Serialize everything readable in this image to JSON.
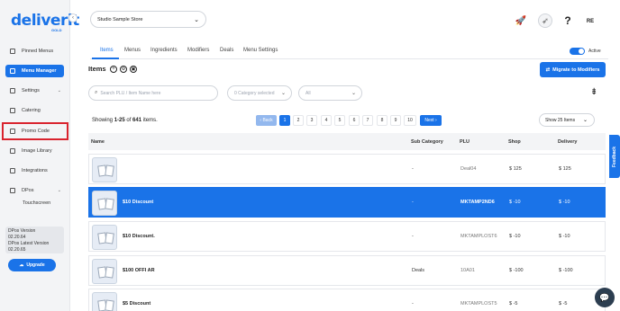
{
  "brand": {
    "logo": "deliverit",
    "logo_sub": "GOLD"
  },
  "sidebar": {
    "items": [
      {
        "label": "Pinned Menus",
        "icon": "pin-icon"
      },
      {
        "label": "Menu Manager",
        "icon": "menu-icon",
        "active": true
      },
      {
        "label": "Settings",
        "icon": "gear-icon"
      },
      {
        "label": "Catering",
        "icon": "catering-icon"
      },
      {
        "label": "Promo Code",
        "icon": "ticket-icon"
      },
      {
        "label": "Image Library",
        "icon": "image-icon"
      },
      {
        "label": "Integrations",
        "icon": "link-icon"
      },
      {
        "label": "DPos",
        "icon": "pos-icon"
      }
    ],
    "sub_item": "Touchscreen",
    "version_label": "DPos Version",
    "version_value": "02.20.64",
    "latest_label": "DPos Latest Version",
    "latest_value": "02.20.65",
    "upgrade_label": "Upgrade"
  },
  "header": {
    "store": "Studio Sample Store",
    "avatar": "RE"
  },
  "tabs": [
    "Items",
    "Menus",
    "Ingredients",
    "Modifiers",
    "Deals",
    "Menu Settings"
  ],
  "active_toggle_label": "Active",
  "items_title": "Items",
  "migrate_label": "Migrate to Modifiers",
  "search_placeholder": "Search PLU / Item Name here",
  "category_placeholder": "0 Category selected",
  "all_placeholder": "All",
  "pagination": {
    "showing_prefix": "Showing ",
    "range": "1-25",
    "of": " of ",
    "total": "641",
    "suffix": " items.",
    "back": "‹ Back",
    "pages": [
      "1",
      "2",
      "3",
      "4",
      "5",
      "6",
      "7",
      "8",
      "9",
      "10"
    ],
    "next": "Next ›",
    "page_size": "Show 25 Items"
  },
  "table": {
    "headers": {
      "name": "Name",
      "sub_category": "Sub Category",
      "plu": "PLU",
      "shop": "Shop",
      "delivery": "Delivery"
    },
    "rows": [
      {
        "name": "",
        "sub_category": "-",
        "plu": "Deal04",
        "shop": "$ 125",
        "delivery": "$ 125"
      },
      {
        "name": "$10 Discount",
        "sub_category": "-",
        "plu": "MKTAMP2ND6",
        "shop": "$ -10",
        "delivery": "$ -10",
        "selected": true
      },
      {
        "name": "$10 Discount.",
        "sub_category": "-",
        "plu": "MKTAMPLOST6",
        "shop": "$ -10",
        "delivery": "$ -10"
      },
      {
        "name": "$100 OFFI AR",
        "sub_category": "Deals",
        "plu": "10A01",
        "shop": "$ -100",
        "delivery": "$ -100"
      },
      {
        "name": "$5 Discount",
        "sub_category": "-",
        "plu": "MKTAMPLOST5",
        "shop": "$ -5",
        "delivery": "$ -5"
      }
    ]
  },
  "feedback_label": "Feedback",
  "colors": {
    "accent": "#1a73e8",
    "highlight": "#d9232e"
  }
}
